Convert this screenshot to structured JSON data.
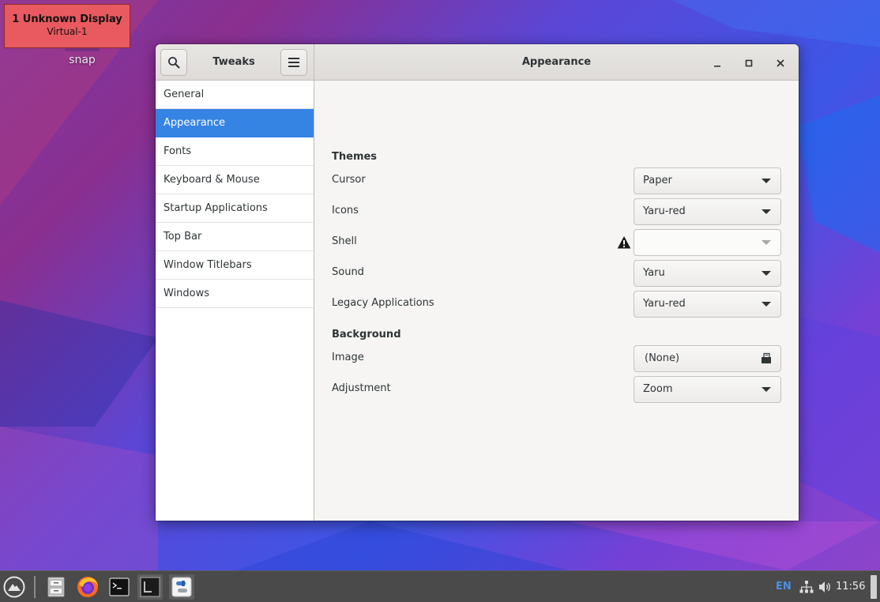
{
  "desktop": {
    "display_label": {
      "line1": "1  Unknown Display",
      "line2": "Virtual-1"
    },
    "icon_label": "snap"
  },
  "window": {
    "sidebar_title": "Tweaks",
    "page_title": "Appearance",
    "search_icon": "search-icon",
    "menu_icon": "hamburger-menu-icon",
    "controls": [
      "minimize-icon",
      "maximize-icon",
      "close-icon"
    ]
  },
  "sidebar": {
    "items": [
      {
        "label": "General"
      },
      {
        "label": "Appearance",
        "selected": true
      },
      {
        "label": "Fonts"
      },
      {
        "label": "Keyboard & Mouse"
      },
      {
        "label": "Startup Applications"
      },
      {
        "label": "Top Bar"
      },
      {
        "label": "Window Titlebars"
      },
      {
        "label": "Windows"
      }
    ]
  },
  "themes": {
    "title": "Themes",
    "cursor": {
      "label": "Cursor",
      "value": "Paper"
    },
    "icons": {
      "label": "Icons",
      "value": "Yaru-red"
    },
    "shell": {
      "label": "Shell",
      "value": "",
      "warning": true
    },
    "sound": {
      "label": "Sound",
      "value": "Yaru"
    },
    "legacy": {
      "label": "Legacy Applications",
      "value": "Yaru-red"
    }
  },
  "background": {
    "title": "Background",
    "image": {
      "label": "Image",
      "value": "(None)"
    },
    "adjustment": {
      "label": "Adjustment",
      "value": "Zoom"
    }
  },
  "taskbar": {
    "apps": [
      "app-menu-icon",
      "file-manager-icon",
      "firefox-icon",
      "terminal-icon",
      "terminal-window-icon",
      "tweaks-icon"
    ],
    "tray": {
      "language": "EN",
      "time": "11:56"
    }
  },
  "colors": {
    "accent": "#3584e4",
    "label_bg": "#e85a60",
    "taskbar": "#4a4a4a"
  }
}
